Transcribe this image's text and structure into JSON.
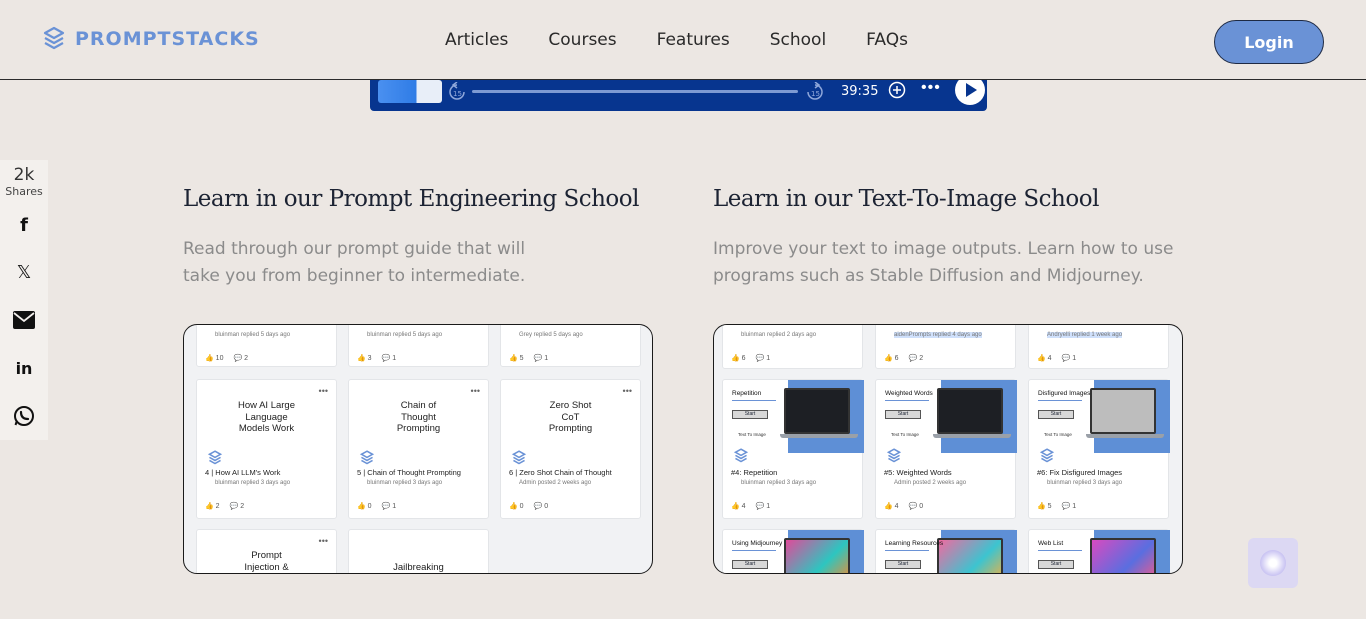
{
  "header": {
    "logo_text": "PROMPTSTACKS",
    "nav": [
      "Articles",
      "Courses",
      "Features",
      "School",
      "FAQs"
    ],
    "login_label": "Login"
  },
  "player": {
    "time": "39:35",
    "rewind": "15",
    "forward": "15"
  },
  "share": {
    "count": "2k",
    "label": "Shares",
    "x_glyph": "𝕏",
    "linkedin_glyph": "in",
    "facebook_glyph": "f"
  },
  "left": {
    "title": "Learn in our Prompt Engineering School",
    "desc_line1": "Read through our prompt guide that will",
    "desc_line2": "take you from beginner to intermediate.",
    "cards": [
      {
        "meta": "bluinman replied 5 days ago",
        "likes": "10",
        "comments": "2"
      },
      {
        "meta": "bluinman replied 5 days ago",
        "likes": "3",
        "comments": "1"
      },
      {
        "meta": "Grey replied 5 days ago",
        "likes": "5",
        "comments": "1"
      },
      {
        "title": [
          "How AI Large",
          "Language",
          "Models Work"
        ],
        "name": "4 | How AI LLM's Work",
        "meta": "bluinman replied 3 days ago",
        "likes": "2",
        "comments": "2"
      },
      {
        "title": [
          "Chain of",
          "Thought",
          "Prompting"
        ],
        "name": "5 | Chain of Thought Prompting",
        "meta": "bluinman replied 3 days ago",
        "likes": "0",
        "comments": "1"
      },
      {
        "title": [
          "Zero Shot",
          "CoT",
          "Prompting"
        ],
        "name": "6 | Zero Shot Chain of Thought",
        "meta": "Admin posted 2 weeks ago",
        "likes": "0",
        "comments": "0"
      },
      {
        "title": [
          "Prompt",
          "Injection &"
        ]
      },
      {
        "title": [
          "Jailbreaking"
        ]
      }
    ]
  },
  "right": {
    "title": "Learn in our Text-To-Image School",
    "desc_line1": "Improve your text to image outputs. Learn how to use",
    "desc_line2": "programs such as Stable Diffusion and Midjourney.",
    "cards": [
      {
        "meta": "bluinman replied 2 days ago",
        "likes": "6",
        "comments": "1"
      },
      {
        "meta": "aidenPrompts replied 4 days ago",
        "likes": "6",
        "comments": "2"
      },
      {
        "meta": "Andryelli replied 1 week ago",
        "likes": "4",
        "comments": "1"
      },
      {
        "label": "Repetition",
        "name": "#4: Repetition",
        "meta": "bluinman replied 3 days ago",
        "likes": "4",
        "comments": "1"
      },
      {
        "label": "Weighted Words",
        "name": "#5: Weighted Words",
        "meta": "Admin posted 2 weeks ago",
        "likes": "4",
        "comments": "0"
      },
      {
        "label": "Disfigured Images",
        "name": "#6: Fix Disfigured Images",
        "meta": "bluinman replied 3 days ago",
        "likes": "5",
        "comments": "1"
      },
      {
        "label": "Using Midjourney"
      },
      {
        "label": "Learning Resources"
      },
      {
        "label": "Web List"
      }
    ],
    "start_label": "Start",
    "t2i_label": "Text To Image"
  },
  "colors": {
    "accent": "#6a92d6",
    "background": "#ece7e3",
    "player": "#07358f"
  }
}
